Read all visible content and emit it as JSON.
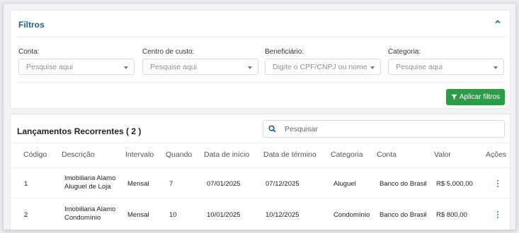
{
  "filters": {
    "title": "Filtros",
    "fields": [
      {
        "label": "Conta:",
        "placeholder": "Pesquise aqui"
      },
      {
        "label": "Centro de custo:",
        "placeholder": "Pesquise aqui"
      },
      {
        "label": "Beneficiário:",
        "placeholder": "Digite o CPF/CNPJ ou nome"
      },
      {
        "label": "Categoria:",
        "placeholder": "Pesquise aqui"
      }
    ],
    "apply_label": "Aplicar filtros"
  },
  "table": {
    "title": "Lançamentos Recorrentes ( 2 )",
    "search_placeholder": "Pesquisar",
    "columns": [
      "Código",
      "Descrição",
      "Intervalo",
      "Quando",
      "Data de início",
      "Data de término",
      "Categoria",
      "Conta",
      "Valor",
      "Ações"
    ],
    "rows": [
      {
        "codigo": "1",
        "descricao_l1": "Imobiliaria Alamo",
        "descricao_l2": "Aluguel de Loja",
        "intervalo": "Mensal",
        "quando": "7",
        "inicio": "07/01/2025",
        "termino": "07/12/2025",
        "categoria": "Aluguel",
        "conta": "Banco do Brasil",
        "valor": "R$ 5.000,00"
      },
      {
        "codigo": "2",
        "descricao_l1": "Imobiliaria Alamo",
        "descricao_l2": "Condomínio",
        "intervalo": "Mensal",
        "quando": "10",
        "inicio": "10/01/2025",
        "termino": "10/12/2025",
        "categoria": "Condomínio",
        "conta": "Banco do Brasil",
        "valor": "R$ 800,00"
      }
    ]
  },
  "colors": {
    "accent": "#1d5f96",
    "apply_button": "#2e9b48",
    "actions": "#1e73c9"
  },
  "icons": {
    "collapse": "chevron-up-icon",
    "filter": "funnel-icon",
    "search": "search-icon",
    "actions": "kebab-menu-icon"
  }
}
